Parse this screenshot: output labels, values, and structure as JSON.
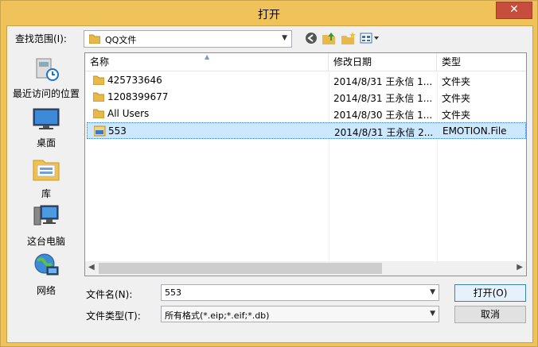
{
  "window": {
    "title": "打开",
    "close_glyph": "✕"
  },
  "lookin": {
    "label": "查找范围(I):",
    "value": "QQ文件"
  },
  "toolbar": {
    "back_icon": "back-icon",
    "up_icon": "up-folder-icon",
    "new_folder_icon": "new-folder-icon",
    "views_icon": "views-menu-icon"
  },
  "places": [
    {
      "label": "最近访问的位置",
      "icon": "recent-places-icon"
    },
    {
      "label": "桌面",
      "icon": "desktop-icon"
    },
    {
      "label": "库",
      "icon": "libraries-icon"
    },
    {
      "label": "这台电脑",
      "icon": "computer-icon"
    },
    {
      "label": "网络",
      "icon": "network-icon"
    }
  ],
  "list": {
    "headers": {
      "name": "名称",
      "date": "修改日期",
      "type": "类型"
    },
    "rows": [
      {
        "name": "425733646",
        "date": "2014/8/31 王永信 1...",
        "type": "文件夹",
        "kind": "folder",
        "selected": false
      },
      {
        "name": "1208399677",
        "date": "2014/8/31 王永信 1...",
        "type": "文件夹",
        "kind": "folder",
        "selected": false
      },
      {
        "name": "All Users",
        "date": "2014/8/30 王永信 1...",
        "type": "文件夹",
        "kind": "folder",
        "selected": false
      },
      {
        "name": "553",
        "date": "2014/8/31 王永信 2...",
        "type": "EMOTION.File",
        "kind": "file",
        "selected": true
      }
    ]
  },
  "filename": {
    "label": "文件名(N):",
    "value": "553"
  },
  "filetype": {
    "label": "文件类型(T):",
    "value": "所有格式(*.eip;*.eif;*.db)"
  },
  "buttons": {
    "open": "打开(O)",
    "cancel": "取消"
  },
  "colors": {
    "frame": "#f0c35a",
    "close": "#c74d3c",
    "selection": "#cce8ff"
  }
}
